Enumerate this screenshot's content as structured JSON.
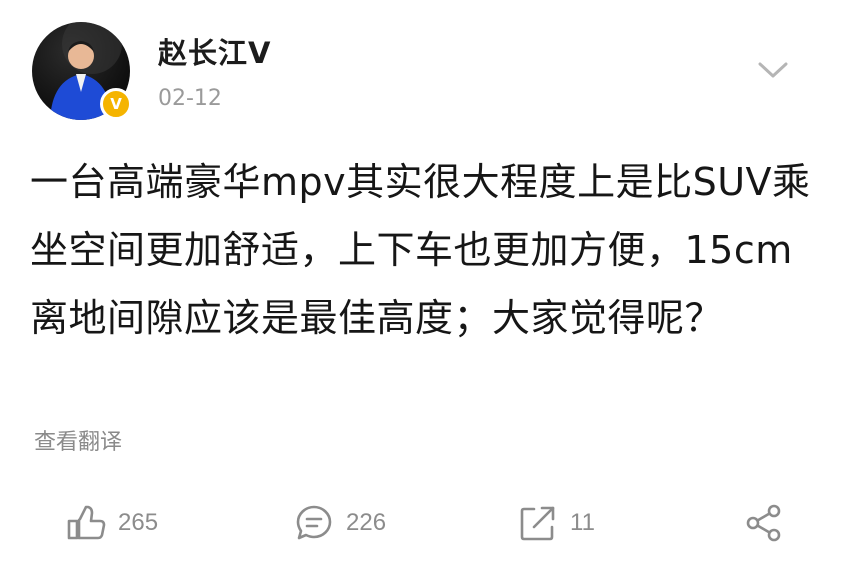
{
  "post": {
    "author": {
      "name": "赵长江V",
      "verified_badge": "V",
      "badge_color": "#f5b400"
    },
    "date": "02-12",
    "text": "一台高端豪华mpv其实很大程度上是比SUV乘坐空间更加舒适，上下车也更加方便，15cm离地间隙应该是最佳高度；大家觉得呢？",
    "translate_label": "查看翻译"
  },
  "actions": {
    "like": {
      "icon": "thumbs-up-icon",
      "count": "265"
    },
    "comment": {
      "icon": "comment-icon",
      "count": "226"
    },
    "repost": {
      "icon": "repost-icon",
      "count": "11"
    },
    "share": {
      "icon": "share-icon"
    }
  },
  "colors": {
    "text": "#161616",
    "meta": "#9a9a9a",
    "icon": "#8c8c8c"
  }
}
